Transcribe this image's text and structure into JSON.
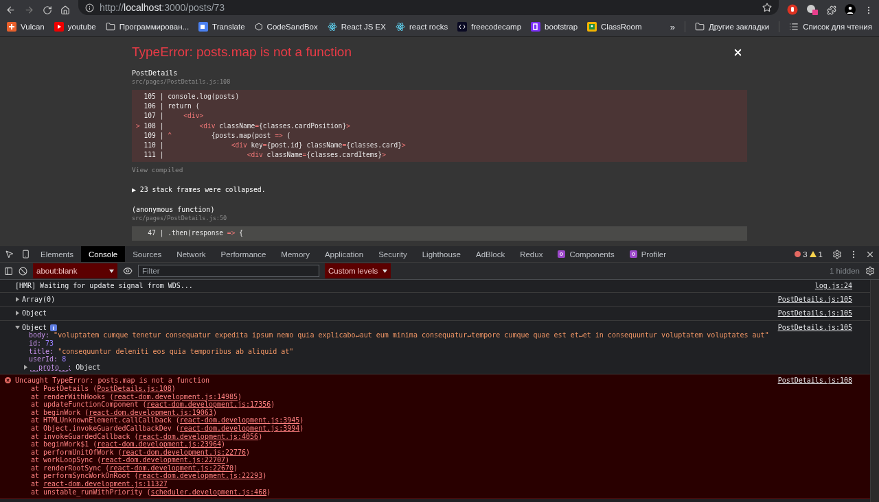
{
  "browser": {
    "url": "http://**localhost**:3000/posts/73",
    "bookmarks": [
      {
        "label": "Vulcan",
        "kind": "vulcan"
      },
      {
        "label": "youtube",
        "kind": "youtube"
      },
      {
        "label": "Программирован...",
        "kind": "folder"
      },
      {
        "label": "Translate",
        "kind": "translate"
      },
      {
        "label": "CodeSandBox",
        "kind": "cube"
      },
      {
        "label": "React JS EX",
        "kind": "react"
      },
      {
        "label": "react rocks",
        "kind": "react"
      },
      {
        "label": "freecodecamp",
        "kind": "fcc"
      },
      {
        "label": "bootstrap",
        "kind": "bootstrap"
      },
      {
        "label": "ClassRoom",
        "kind": "classroom"
      }
    ],
    "more": "»",
    "other_bookmarks": "Другие закладки",
    "reading_list": "Список для чтения"
  },
  "error_overlay": {
    "title": "TypeError: posts.map is not a function",
    "component": "PostDetails",
    "file": "src/pages/PostDetails.js:108",
    "code": [
      [
        {
          "text": "  105 | console.log(posts)",
          "kind": "plain"
        }
      ],
      [
        {
          "text": "  106 | return (",
          "kind": "plain"
        }
      ],
      [
        {
          "text": "  107 |     ",
          "kind": "plain"
        },
        {
          "text": "<div>",
          "kind": "tag"
        }
      ],
      [
        {
          "text": "> ",
          "kind": "tag"
        },
        {
          "text": "108 |         ",
          "kind": "plain"
        },
        {
          "text": "<div",
          "kind": "tag"
        },
        {
          "text": " className",
          "kind": "plain"
        },
        {
          "text": "=",
          "kind": "tag"
        },
        {
          "text": "{classes.cardPosition}",
          "kind": "plain"
        },
        {
          "text": ">",
          "kind": "tag"
        }
      ],
      [
        {
          "text": "  109 | ",
          "kind": "plain"
        },
        {
          "text": "^",
          "kind": "tag"
        },
        {
          "text": "          {posts.map(post ",
          "kind": "plain"
        },
        {
          "text": "=>",
          "kind": "tag"
        },
        {
          "text": " (",
          "kind": "plain"
        }
      ],
      [
        {
          "text": "  110 |                 ",
          "kind": "plain"
        },
        {
          "text": "<div",
          "kind": "tag"
        },
        {
          "text": " key",
          "kind": "plain"
        },
        {
          "text": "=",
          "kind": "tag"
        },
        {
          "text": "{post.id}",
          "kind": "plain"
        },
        {
          "text": " className",
          "kind": "plain"
        },
        {
          "text": "=",
          "kind": "tag"
        },
        {
          "text": "{classes.card}",
          "kind": "plain"
        },
        {
          "text": ">",
          "kind": "tag"
        }
      ],
      [
        {
          "text": "  111 |                     ",
          "kind": "plain"
        },
        {
          "text": "<div",
          "kind": "tag"
        },
        {
          "text": " className",
          "kind": "plain"
        },
        {
          "text": "=",
          "kind": "tag"
        },
        {
          "text": "{classes.cardItems}",
          "kind": "plain"
        },
        {
          "text": ">",
          "kind": "tag"
        }
      ]
    ],
    "view_compiled": "View compiled",
    "collapsed_text": "▶ 23 stack frames were collapsed.",
    "second_component": "(anonymous function)",
    "second_file": "src/pages/PostDetails.js:50",
    "second_code": [
      [
        {
          "text": "   47 | .then(response ",
          "kind": "plain"
        },
        {
          "text": "=>",
          "kind": "tag"
        },
        {
          "text": " {",
          "kind": "plain"
        }
      ]
    ]
  },
  "devtools": {
    "tabs": [
      {
        "label": "Elements",
        "selected": false
      },
      {
        "label": "Console",
        "selected": true
      },
      {
        "label": "Sources",
        "selected": false
      },
      {
        "label": "Network",
        "selected": false
      },
      {
        "label": "Performance",
        "selected": false
      },
      {
        "label": "Memory",
        "selected": false
      },
      {
        "label": "Application",
        "selected": false
      },
      {
        "label": "Security",
        "selected": false
      },
      {
        "label": "Lighthouse",
        "selected": false
      },
      {
        "label": "AdBlock",
        "selected": false
      },
      {
        "label": "Redux",
        "selected": false
      },
      {
        "label": "Components",
        "selected": false,
        "kind": "react"
      },
      {
        "label": "Profiler",
        "selected": false,
        "kind": "react"
      }
    ],
    "error_count": "3",
    "warning_count": "1",
    "context": "about:blank",
    "filter_placeholder": "Filter",
    "levels": "Custom levels",
    "hidden": "1 hidden",
    "messages": [
      {
        "kind": "text",
        "text": "[HMR] Waiting for update signal from WDS...",
        "source": "log.js:24"
      },
      {
        "kind": "object",
        "label": "Array(0)",
        "expanded": false,
        "source": "PostDetails.js:105"
      },
      {
        "kind": "object",
        "label": "Object",
        "expanded": false,
        "source": "PostDetails.js:105"
      },
      {
        "kind": "object",
        "label": "Object",
        "expanded": true,
        "source": "PostDetails.js:105",
        "properties": [
          {
            "key": "body:",
            "value": "\"voluptatem cumque tenetur consequatur expedita ipsum nemo quia explicabo↵aut eum minima consequatur↵tempore cumque quae est et↵et in consequuntur voluptatem voluptates aut\"",
            "kind": "string"
          },
          {
            "key": "id:",
            "value": "73",
            "kind": "number"
          },
          {
            "key": "title:",
            "value": "\"consequuntur deleniti eos quia temporibus ab aliquid at\"",
            "kind": "string"
          },
          {
            "key": "userId:",
            "value": "8",
            "kind": "number"
          },
          {
            "key": "__proto__:",
            "value": "Object",
            "kind": "proto"
          }
        ]
      },
      {
        "kind": "error",
        "text": "Uncaught TypeError: posts.map is not a function",
        "source": "PostDetails.js:108",
        "frames": [
          {
            "text": "at PostDetails (",
            "location": "PostDetails.js:108",
            "end": ")"
          },
          {
            "text": "at renderWithHooks (",
            "location": "react-dom.development.js:14985",
            "end": ")"
          },
          {
            "text": "at updateFunctionComponent (",
            "location": "react-dom.development.js:17356",
            "end": ")"
          },
          {
            "text": "at beginWork (",
            "location": "react-dom.development.js:19063",
            "end": ")"
          },
          {
            "text": "at HTMLUnknownElement.callCallback (",
            "location": "react-dom.development.js:3945",
            "end": ")"
          },
          {
            "text": "at Object.invokeGuardedCallbackDev (",
            "location": "react-dom.development.js:3994",
            "end": ")"
          },
          {
            "text": "at invokeGuardedCallback (",
            "location": "react-dom.development.js:4056",
            "end": ")"
          },
          {
            "text": "at beginWork$1 (",
            "location": "react-dom.development.js:23964",
            "end": ")"
          },
          {
            "text": "at performUnitOfWork (",
            "location": "react-dom.development.js:22776",
            "end": ")"
          },
          {
            "text": "at workLoopSync (",
            "location": "react-dom.development.js:22707",
            "end": ")"
          },
          {
            "text": "at renderRootSync (",
            "location": "react-dom.development.js:22670",
            "end": ")"
          },
          {
            "text": "at performSyncWorkOnRoot (",
            "location": "react-dom.development.js:22293",
            "end": ")"
          },
          {
            "text": "at ",
            "location": "react-dom.development.js:11327"
          },
          {
            "text": "at unstable_runWithPriority (",
            "location": "scheduler.development.js:468",
            "end": ")"
          }
        ]
      }
    ]
  }
}
